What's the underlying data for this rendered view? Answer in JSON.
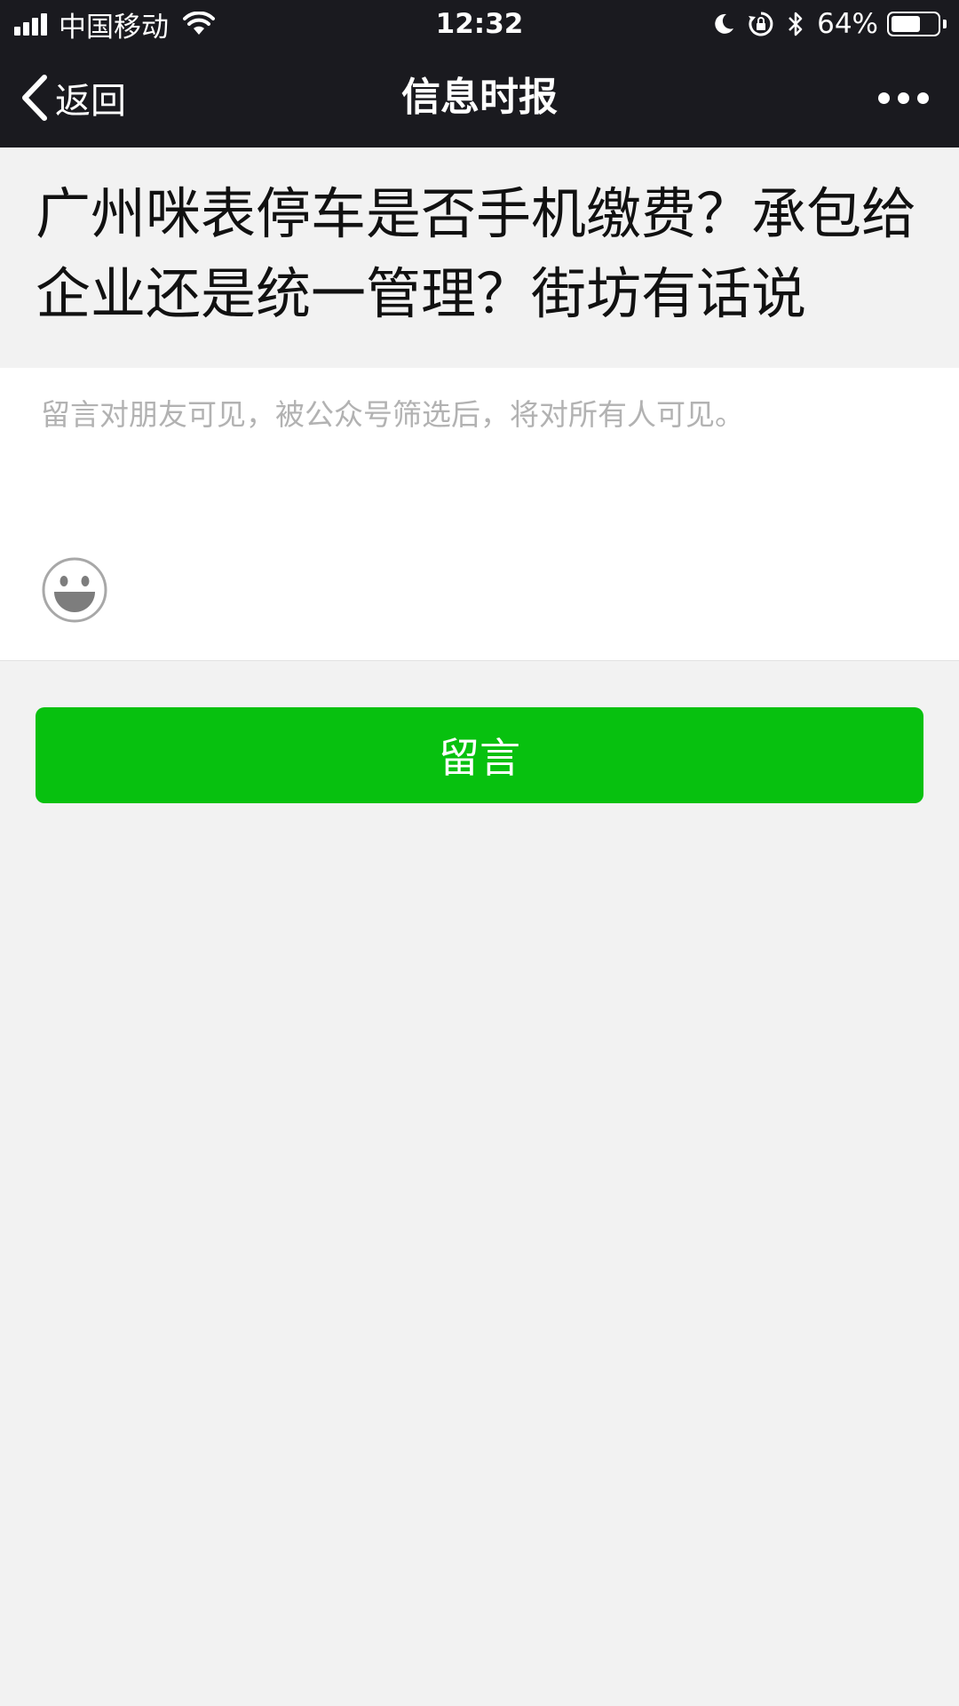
{
  "status_bar": {
    "carrier": "中国移动",
    "time": "12:32",
    "battery_percent": "64%",
    "battery_level": 0.64
  },
  "nav": {
    "back_label": "返回",
    "title": "信息时报"
  },
  "article": {
    "title": "广州咪表停车是否手机缴费？承包给企业还是统一管理？街坊有话说"
  },
  "comment": {
    "placeholder": "留言对朋友可见，被公众号筛选后，将对所有人可见。",
    "value": "",
    "emoji_icon": "smiley-face-icon"
  },
  "submit": {
    "label": "留言",
    "color": "#07c10f"
  },
  "icons": [
    "signal-bars-icon",
    "wifi-icon",
    "moon-icon",
    "rotation-lock-icon",
    "bluetooth-icon",
    "battery-icon",
    "back-chevron-icon",
    "more-dots-icon",
    "smiley-face-icon"
  ]
}
